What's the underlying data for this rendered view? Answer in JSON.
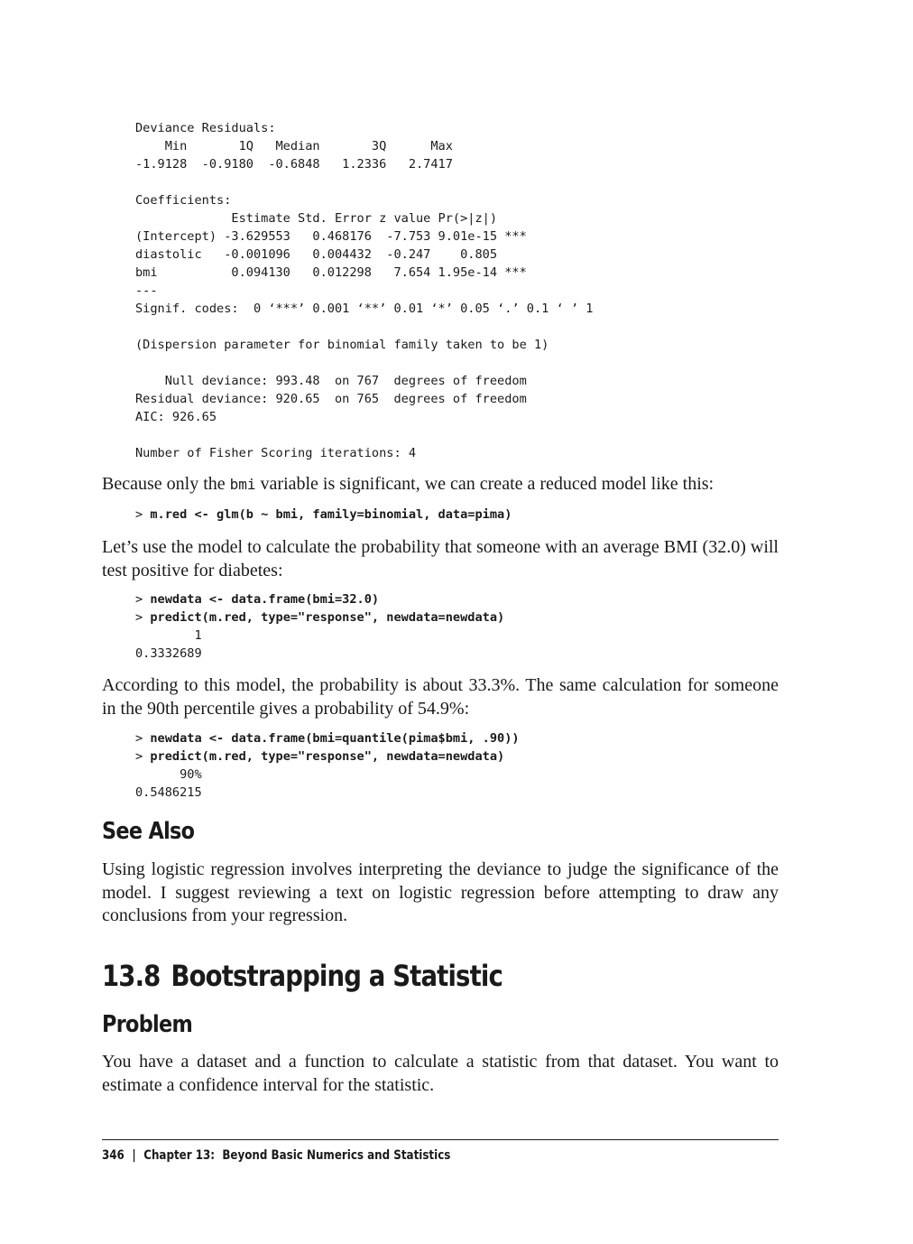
{
  "code_block_1": {
    "lines": [
      "Deviance Residuals:",
      "    Min       1Q   Median       3Q      Max",
      "-1.9128  -0.9180  -0.6848   1.2336   2.7417",
      "",
      "Coefficients:",
      "             Estimate Std. Error z value Pr(>|z|)",
      "(Intercept) -3.629553   0.468176  -7.753 9.01e-15 ***",
      "diastolic   -0.001096   0.004432  -0.247    0.805",
      "bmi          0.094130   0.012298   7.654 1.95e-14 ***",
      "---",
      "Signif. codes:  0 ‘***’ 0.001 ‘**’ 0.01 ‘*’ 0.05 ‘.’ 0.1 ‘ ’ 1",
      "",
      "(Dispersion parameter for binomial family taken to be 1)",
      "",
      "    Null deviance: 993.48  on 767  degrees of freedom",
      "Residual deviance: 920.65  on 765  degrees of freedom",
      "AIC: 926.65",
      "",
      "Number of Fisher Scoring iterations: 4"
    ]
  },
  "para_1": {
    "before": "Because only the ",
    "code": "bmi",
    "after": " variable is significant, we can create a reduced model like this:"
  },
  "code_block_2": {
    "prompt": "> ",
    "command": "m.red <- glm(b ~ bmi, family=binomial, data=pima)"
  },
  "para_2": {
    "text": "Let’s use the model to calculate the probability that someone with an average BMI (32.0) will test positive for diabetes:"
  },
  "code_block_3": {
    "prompt": "> ",
    "command_1": "newdata <- data.frame(bmi=32.0)",
    "command_2": "predict(m.red, type=\"response\", newdata=newdata)",
    "output_1": "        1",
    "output_2": "0.3332689"
  },
  "para_3": {
    "text": "According to this model, the probability is about 33.3%. The same calculation for someone in the 90th percentile gives a probability of 54.9%:"
  },
  "code_block_4": {
    "prompt": "> ",
    "command_1": "newdata <- data.frame(bmi=quantile(pima$bmi, .90))",
    "command_2": "predict(m.red, type=\"response\", newdata=newdata)",
    "output_1": "      90%",
    "output_2": "0.5486215"
  },
  "see_also": {
    "heading": "See Also",
    "text": "Using logistic regression involves interpreting the deviance to judge the significance of the model. I suggest reviewing a text on logistic regression before attempting to draw any conclusions from your regression."
  },
  "section": {
    "number": "13.8",
    "title": "Bootstrapping a Statistic"
  },
  "problem": {
    "heading": "Problem",
    "text": "You have a dataset and a function to calculate a statistic from that dataset. You want to estimate a confidence interval for the statistic."
  },
  "footer": {
    "page_number": "346",
    "separator": "|",
    "chapter": "Chapter 13:  Beyond Basic Numerics and Statistics"
  }
}
